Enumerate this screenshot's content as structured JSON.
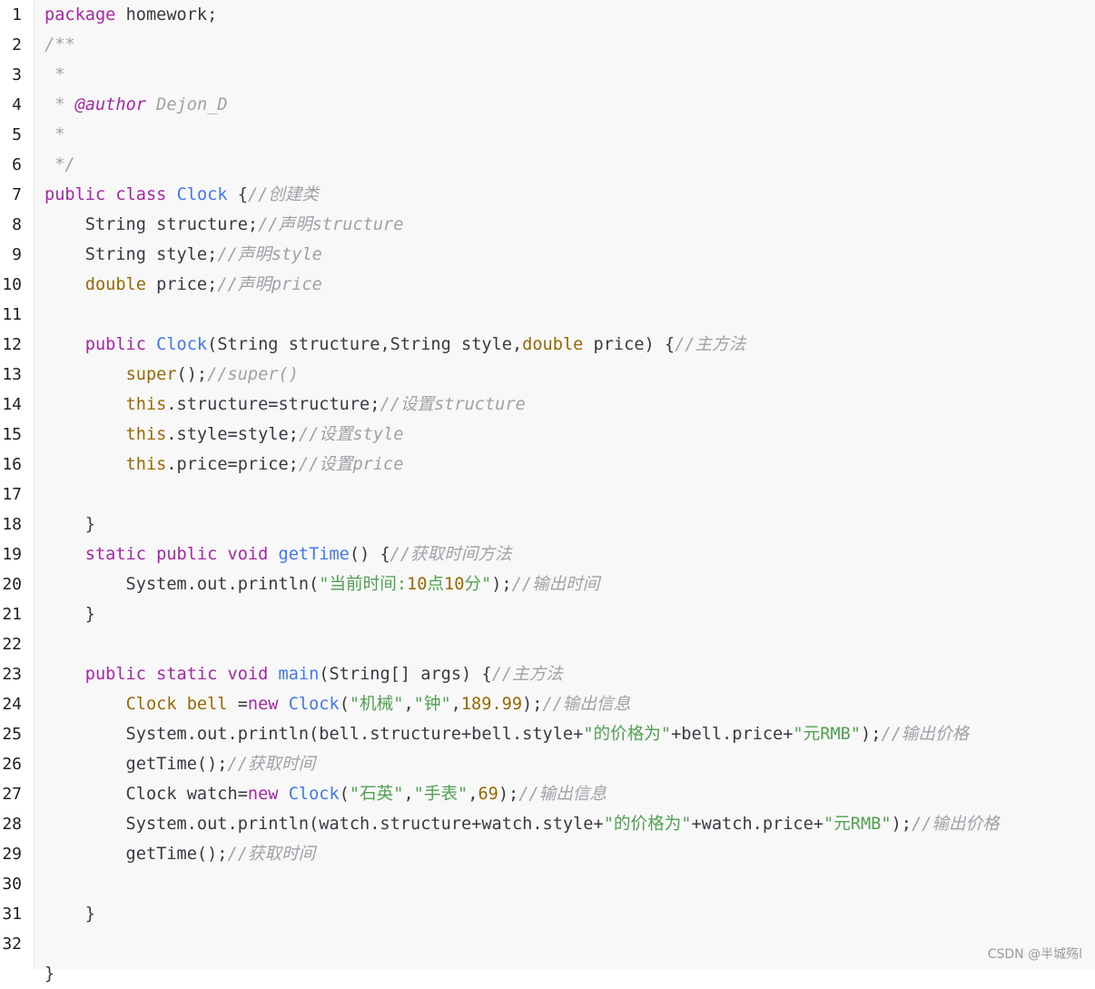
{
  "editor": {
    "lines": [
      {
        "n": "1",
        "tokens": [
          {
            "t": "package",
            "c": "kw"
          },
          {
            "t": " homework;",
            "c": "plain"
          }
        ]
      },
      {
        "n": "2",
        "tokens": [
          {
            "t": "/**",
            "c": "com"
          }
        ]
      },
      {
        "n": "3",
        "tokens": [
          {
            "t": " *",
            "c": "com"
          }
        ]
      },
      {
        "n": "4",
        "tokens": [
          {
            "t": " * ",
            "c": "com"
          },
          {
            "t": "@author",
            "c": "tag"
          },
          {
            "t": " Dejon_D",
            "c": "com"
          }
        ]
      },
      {
        "n": "5",
        "tokens": [
          {
            "t": " *",
            "c": "com"
          }
        ]
      },
      {
        "n": "6",
        "tokens": [
          {
            "t": " */",
            "c": "com"
          }
        ]
      },
      {
        "n": "7",
        "tokens": [
          {
            "t": "public",
            "c": "kw"
          },
          {
            "t": " ",
            "c": "plain"
          },
          {
            "t": "class",
            "c": "kw"
          },
          {
            "t": " ",
            "c": "plain"
          },
          {
            "t": "Clock",
            "c": "fn"
          },
          {
            "t": " {",
            "c": "plain"
          },
          {
            "t": "//创建类",
            "c": "com"
          }
        ]
      },
      {
        "n": "8",
        "tokens": [
          {
            "t": "    String structure;",
            "c": "plain"
          },
          {
            "t": "//声明structure",
            "c": "com"
          }
        ]
      },
      {
        "n": "9",
        "tokens": [
          {
            "t": "    String style;",
            "c": "plain"
          },
          {
            "t": "//声明style",
            "c": "com"
          }
        ]
      },
      {
        "n": "10",
        "tokens": [
          {
            "t": "    ",
            "c": "plain"
          },
          {
            "t": "double",
            "c": "type"
          },
          {
            "t": " price;",
            "c": "plain"
          },
          {
            "t": "//声明price",
            "c": "com"
          }
        ]
      },
      {
        "n": "11",
        "tokens": []
      },
      {
        "n": "12",
        "tokens": [
          {
            "t": "    ",
            "c": "plain"
          },
          {
            "t": "public",
            "c": "kw"
          },
          {
            "t": " ",
            "c": "plain"
          },
          {
            "t": "Clock",
            "c": "fn"
          },
          {
            "t": "(String structure,String style,",
            "c": "plain"
          },
          {
            "t": "double",
            "c": "type"
          },
          {
            "t": " price) {",
            "c": "plain"
          },
          {
            "t": "//主方法",
            "c": "com"
          }
        ]
      },
      {
        "n": "13",
        "tokens": [
          {
            "t": "        ",
            "c": "plain"
          },
          {
            "t": "super",
            "c": "type"
          },
          {
            "t": "();",
            "c": "plain"
          },
          {
            "t": "//super()",
            "c": "com"
          }
        ]
      },
      {
        "n": "14",
        "tokens": [
          {
            "t": "        ",
            "c": "plain"
          },
          {
            "t": "this",
            "c": "type"
          },
          {
            "t": ".structure=structure;",
            "c": "plain"
          },
          {
            "t": "//设置structure",
            "c": "com"
          }
        ]
      },
      {
        "n": "15",
        "tokens": [
          {
            "t": "        ",
            "c": "plain"
          },
          {
            "t": "this",
            "c": "type"
          },
          {
            "t": ".style=style;",
            "c": "plain"
          },
          {
            "t": "//设置style",
            "c": "com"
          }
        ]
      },
      {
        "n": "16",
        "tokens": [
          {
            "t": "        ",
            "c": "plain"
          },
          {
            "t": "this",
            "c": "type"
          },
          {
            "t": ".price=price;",
            "c": "plain"
          },
          {
            "t": "//设置price",
            "c": "com"
          }
        ]
      },
      {
        "n": "17",
        "tokens": []
      },
      {
        "n": "18",
        "tokens": [
          {
            "t": "    }",
            "c": "plain"
          }
        ]
      },
      {
        "n": "19",
        "tokens": [
          {
            "t": "    ",
            "c": "plain"
          },
          {
            "t": "static",
            "c": "kw"
          },
          {
            "t": " ",
            "c": "plain"
          },
          {
            "t": "public",
            "c": "kw"
          },
          {
            "t": " ",
            "c": "plain"
          },
          {
            "t": "void",
            "c": "kw"
          },
          {
            "t": " ",
            "c": "plain"
          },
          {
            "t": "getTime",
            "c": "fn"
          },
          {
            "t": "() {",
            "c": "plain"
          },
          {
            "t": "//获取时间方法",
            "c": "com"
          }
        ]
      },
      {
        "n": "20",
        "tokens": [
          {
            "t": "        System.out.println(",
            "c": "plain"
          },
          {
            "t": "\"当前时间:",
            "c": "str"
          },
          {
            "t": "10",
            "c": "num"
          },
          {
            "t": "点",
            "c": "str"
          },
          {
            "t": "10",
            "c": "num"
          },
          {
            "t": "分\"",
            "c": "str"
          },
          {
            "t": ");",
            "c": "plain"
          },
          {
            "t": "//输出时间",
            "c": "com"
          }
        ]
      },
      {
        "n": "21",
        "tokens": [
          {
            "t": "    }",
            "c": "plain"
          }
        ]
      },
      {
        "n": "22",
        "tokens": []
      },
      {
        "n": "23",
        "tokens": [
          {
            "t": "    ",
            "c": "plain"
          },
          {
            "t": "public",
            "c": "kw"
          },
          {
            "t": " ",
            "c": "plain"
          },
          {
            "t": "static",
            "c": "kw"
          },
          {
            "t": " ",
            "c": "plain"
          },
          {
            "t": "void",
            "c": "kw"
          },
          {
            "t": " ",
            "c": "plain"
          },
          {
            "t": "main",
            "c": "fn"
          },
          {
            "t": "(String[] args) {",
            "c": "plain"
          },
          {
            "t": "//主方法",
            "c": "com"
          }
        ]
      },
      {
        "n": "24",
        "tokens": [
          {
            "t": "        ",
            "c": "plain"
          },
          {
            "t": "Clock bell",
            "c": "type"
          },
          {
            "t": " =",
            "c": "plain"
          },
          {
            "t": "new",
            "c": "kw"
          },
          {
            "t": " ",
            "c": "plain"
          },
          {
            "t": "Clock",
            "c": "fn"
          },
          {
            "t": "(",
            "c": "plain"
          },
          {
            "t": "\"机械\"",
            "c": "str"
          },
          {
            "t": ",",
            "c": "plain"
          },
          {
            "t": "\"钟\"",
            "c": "str"
          },
          {
            "t": ",",
            "c": "plain"
          },
          {
            "t": "189.99",
            "c": "num"
          },
          {
            "t": ");",
            "c": "plain"
          },
          {
            "t": "//输出信息",
            "c": "com"
          }
        ]
      },
      {
        "n": "25",
        "tokens": [
          {
            "t": "        System.out.println(bell.structure+bell.style+",
            "c": "plain"
          },
          {
            "t": "\"的价格为\"",
            "c": "str"
          },
          {
            "t": "+bell.price+",
            "c": "plain"
          },
          {
            "t": "\"元RMB\"",
            "c": "str"
          },
          {
            "t": ");",
            "c": "plain"
          },
          {
            "t": "//输出价格",
            "c": "com"
          }
        ]
      },
      {
        "n": "26",
        "tokens": [
          {
            "t": "        getTime();",
            "c": "plain"
          },
          {
            "t": "//获取时间",
            "c": "com"
          }
        ]
      },
      {
        "n": "27",
        "tokens": [
          {
            "t": "        Clock watch=",
            "c": "plain"
          },
          {
            "t": "new",
            "c": "kw"
          },
          {
            "t": " ",
            "c": "plain"
          },
          {
            "t": "Clock",
            "c": "fn"
          },
          {
            "t": "(",
            "c": "plain"
          },
          {
            "t": "\"石英\"",
            "c": "str"
          },
          {
            "t": ",",
            "c": "plain"
          },
          {
            "t": "\"手表\"",
            "c": "str"
          },
          {
            "t": ",",
            "c": "plain"
          },
          {
            "t": "69",
            "c": "num"
          },
          {
            "t": ");",
            "c": "plain"
          },
          {
            "t": "//输出信息",
            "c": "com"
          }
        ]
      },
      {
        "n": "28",
        "tokens": [
          {
            "t": "        System.out.println(watch.structure+watch.style+",
            "c": "plain"
          },
          {
            "t": "\"的价格为\"",
            "c": "str"
          },
          {
            "t": "+watch.price+",
            "c": "plain"
          },
          {
            "t": "\"元RMB\"",
            "c": "str"
          },
          {
            "t": ");",
            "c": "plain"
          },
          {
            "t": "//输出价格",
            "c": "com"
          }
        ]
      },
      {
        "n": "29",
        "tokens": [
          {
            "t": "        getTime();",
            "c": "plain"
          },
          {
            "t": "//获取时间",
            "c": "com"
          }
        ]
      },
      {
        "n": "30",
        "tokens": []
      },
      {
        "n": "31",
        "tokens": [
          {
            "t": "    }",
            "c": "plain"
          }
        ]
      },
      {
        "n": "32",
        "tokens": []
      },
      {
        "n": "",
        "tokens": [
          {
            "t": "}",
            "c": "plain"
          }
        ]
      }
    ]
  },
  "watermark": "CSDN @半城殇l"
}
